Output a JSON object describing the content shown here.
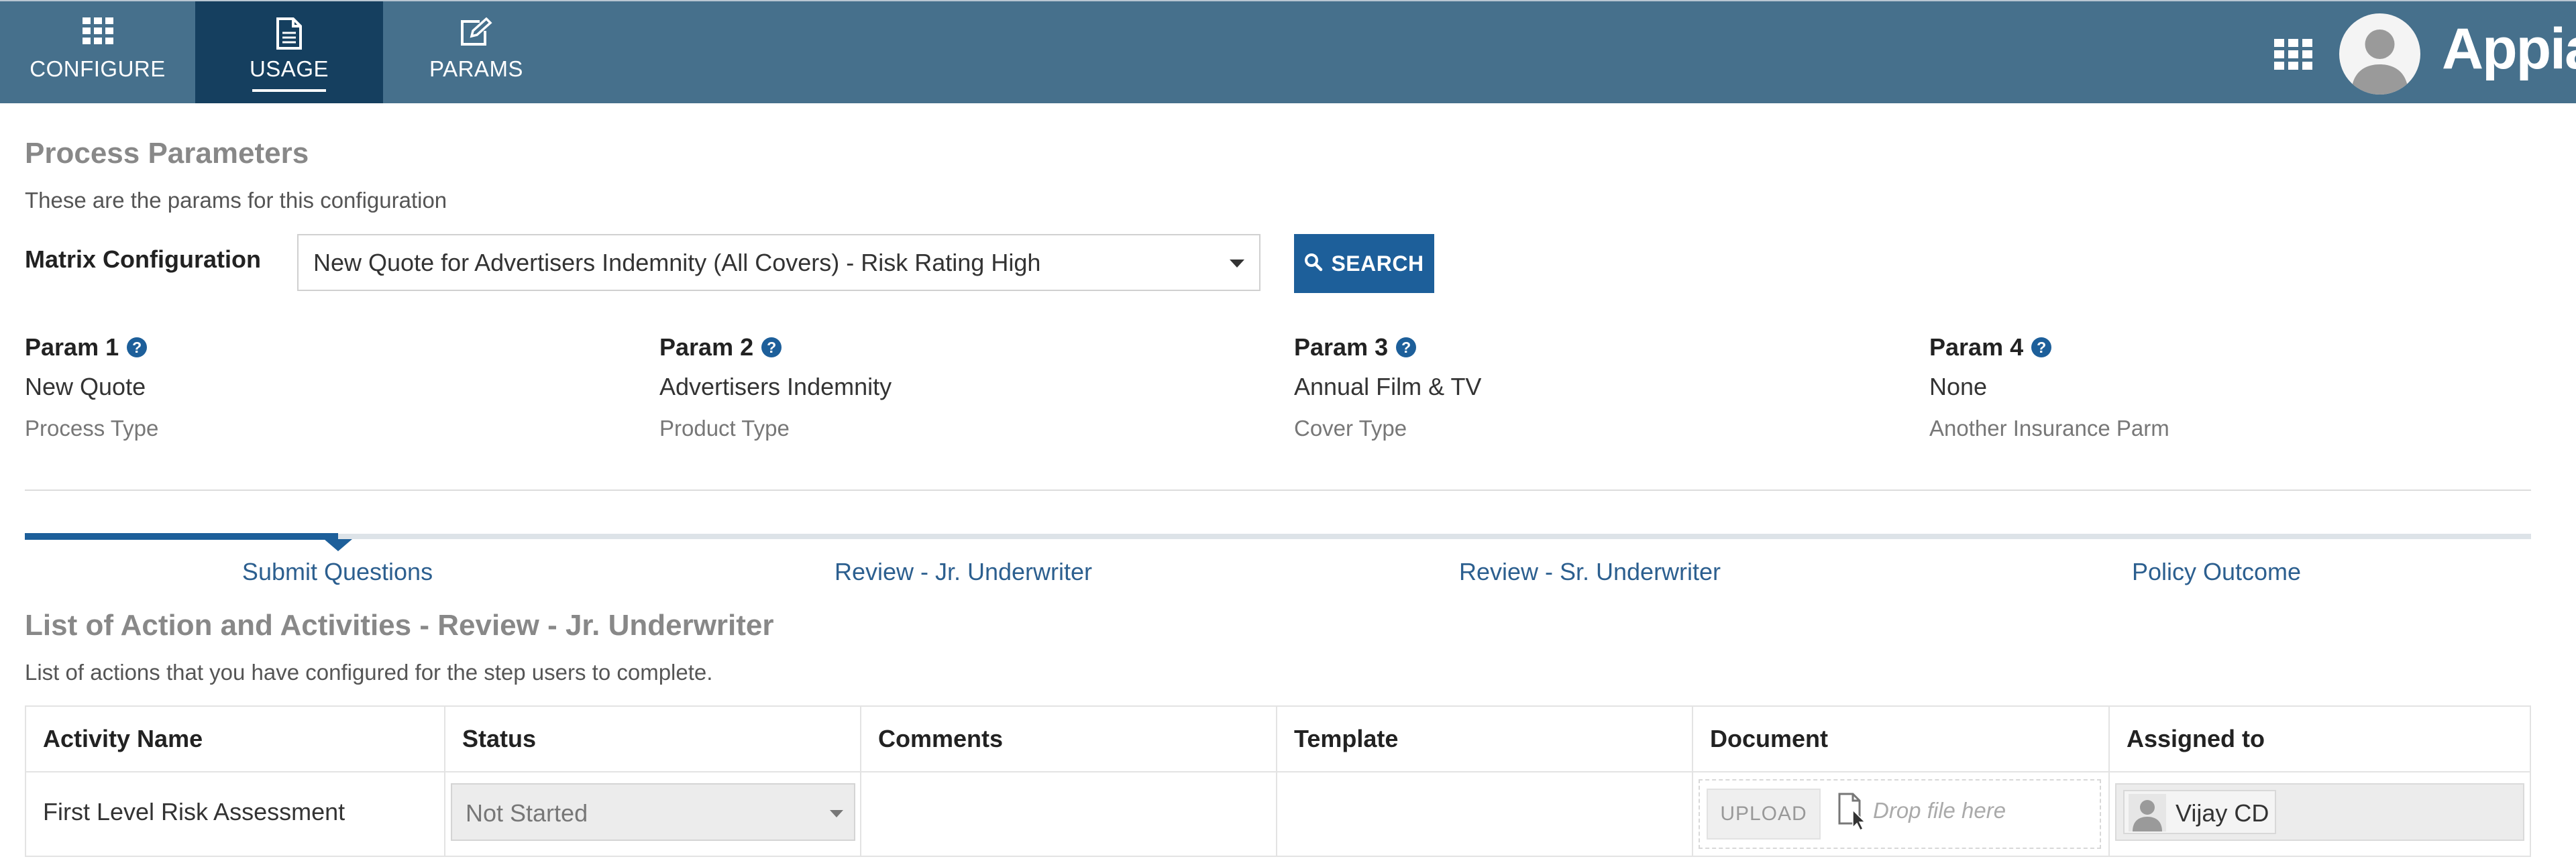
{
  "nav": {
    "tabs": [
      {
        "label": "CONFIGURE",
        "icon": "grid-icon"
      },
      {
        "label": "USAGE",
        "icon": "document-icon",
        "active": true
      },
      {
        "label": "PARAMS",
        "icon": "edit-icon"
      }
    ],
    "brand": "Appian"
  },
  "process": {
    "title": "Process Parameters",
    "subtitle": "These are the params for this configuration"
  },
  "matrix": {
    "label": "Matrix Configuration",
    "selected": "New Quote for Advertisers Indemnity (All Covers) - Risk Rating High",
    "search_label": "SEARCH"
  },
  "params": [
    {
      "name": "Param 1",
      "value": "New Quote",
      "type": "Process Type"
    },
    {
      "name": "Param 2",
      "value": "Advertisers Indemnity",
      "type": "Product Type"
    },
    {
      "name": "Param 3",
      "value": "Annual Film & TV",
      "type": "Cover Type"
    },
    {
      "name": "Param 4",
      "value": "None",
      "type": "Another Insurance Parm"
    }
  ],
  "steps": {
    "items": [
      "Submit Questions",
      "Review - Jr. Underwriter",
      "Review - Sr. Underwriter",
      "Policy Outcome"
    ],
    "active_index": 0
  },
  "list": {
    "title": "List of Action and Activities - Review - Jr. Underwriter",
    "subtitle": "List of actions that you have configured for the step users to complete.",
    "columns": [
      "Activity Name",
      "Status",
      "Comments",
      "Template",
      "Document",
      "Assigned to"
    ],
    "rows": [
      {
        "activity": "First Level Risk Assessment",
        "status": "Not Started",
        "comments": "",
        "template": "",
        "upload_label": "UPLOAD",
        "drop_text": "Drop file here",
        "assigned": "Vijay CD"
      }
    ]
  },
  "colors": {
    "topbar": "#46708c",
    "active_tab": "#153f5f",
    "accent": "#1d5f9a",
    "step_text": "#2c5f8f"
  }
}
